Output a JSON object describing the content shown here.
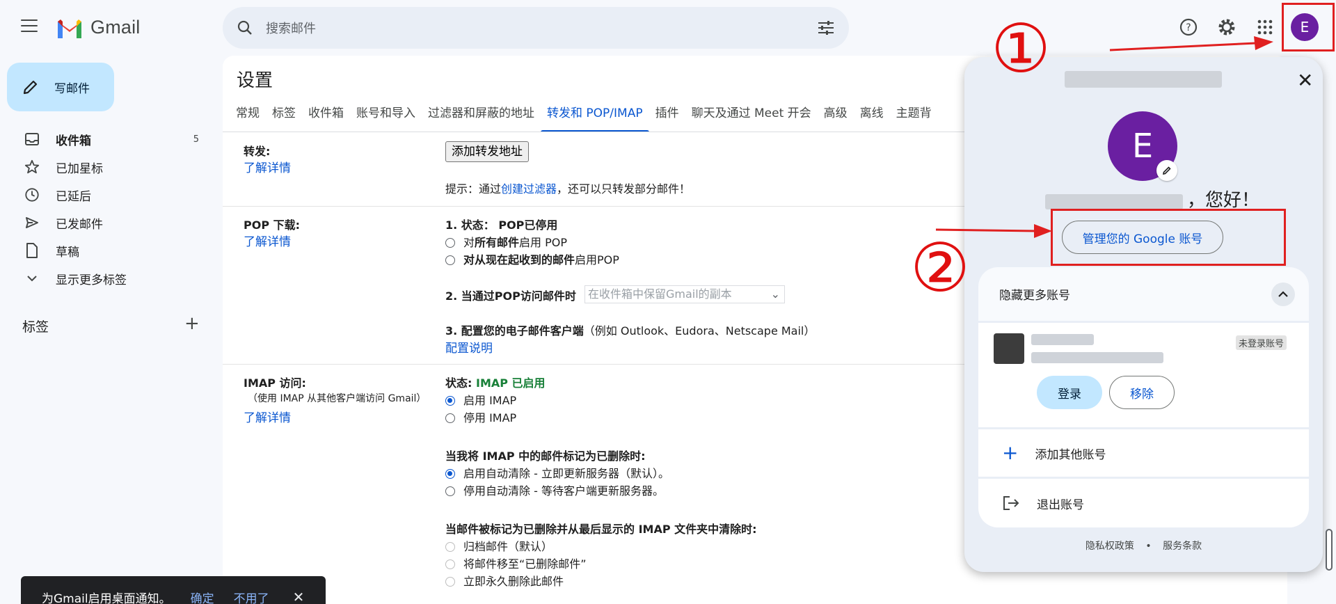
{
  "app": {
    "name": "Gmail"
  },
  "search": {
    "placeholder": "搜索邮件"
  },
  "compose": {
    "label": "写邮件"
  },
  "nav": {
    "items": [
      {
        "label": "收件箱",
        "count": "5"
      },
      {
        "label": "已加星标"
      },
      {
        "label": "已延后"
      },
      {
        "label": "已发邮件"
      },
      {
        "label": "草稿"
      },
      {
        "label": "显示更多标签"
      }
    ],
    "labels_title": "标签"
  },
  "settings": {
    "title": "设置",
    "tabs": [
      "常规",
      "标签",
      "收件箱",
      "账号和导入",
      "过滤器和屏蔽的地址",
      "转发和 POP/IMAP",
      "插件",
      "聊天及通过 Meet 开会",
      "高级",
      "离线",
      "主题背"
    ],
    "forwarding": {
      "label": "转发:",
      "learn": "了解详情",
      "add_button": "添加转发地址",
      "hint_prefix": "提示：通过",
      "hint_link": "创建过滤器",
      "hint_suffix": "，还可以只转发部分邮件！"
    },
    "pop": {
      "label": "POP 下载:",
      "learn": "了解详情",
      "status": "1. 状态：  POP已停用",
      "opt1_a": "对",
      "opt1_b": "所有邮件",
      "opt1_c": "启用 POP",
      "opt2_b": "对从现在起收到的邮件",
      "opt2_c": "启用POP",
      "when_label": "2. 当通过POP访问邮件时",
      "select_value": "在收件箱中保留Gmail的副本",
      "config_bold": "3. 配置您的电子邮件客户端",
      "config_rest": "（例如 Outlook、Eudora、Netscape Mail）",
      "config_link": "配置说明"
    },
    "imap": {
      "label": "IMAP 访问:",
      "sub": "（使用 IMAP 从其他客户端访问 Gmail）",
      "learn": "了解详情",
      "status_label": "状态: ",
      "status_value": "IMAP 已启用",
      "enable": "启用 IMAP",
      "disable": "停用 IMAP",
      "deleted_title": "当我将 IMAP 中的邮件标记为已删除时:",
      "auto_on": "启用自动清除 - 立即更新服务器（默认）。",
      "auto_off": "停用自动清除 - 等待客户端更新服务器。",
      "expunge_title": "当邮件被标记为已删除并从最后显示的 IMAP 文件夹中清除时:",
      "archive": "归档邮件（默认）",
      "trash": "将邮件移至“已删除邮件”",
      "delete_forever": "立即永久删除此邮件"
    }
  },
  "toast": {
    "text": "为Gmail启用桌面通知。",
    "ok": "确定",
    "no": "不用了"
  },
  "account": {
    "avatar_letter": "E",
    "greeting": "，您好！",
    "manage": "管理您的 Google 账号",
    "hide_more": "隐藏更多账号",
    "not_signed_in": "未登录账号",
    "login": "登录",
    "remove": "移除",
    "add_account": "添加其他账号",
    "sign_out": "退出账号",
    "privacy": "隐私权政策",
    "dot": "•",
    "terms": "服务条款"
  },
  "annotations": {
    "one": "①",
    "two": "②"
  },
  "colors": {
    "accent": "#0b57d0",
    "avatar": "#6a1fa1",
    "annotation": "#e02020",
    "imap_on": "#188038"
  }
}
